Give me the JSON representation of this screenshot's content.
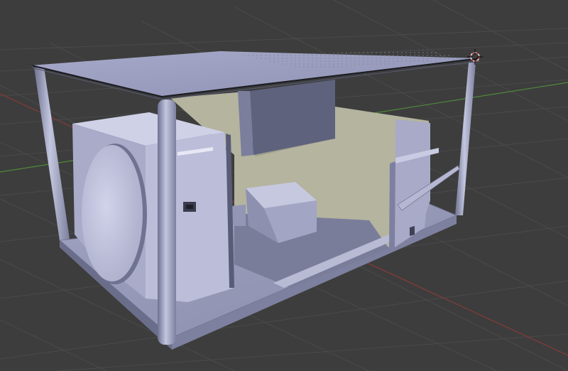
{
  "viewport": {
    "background_color": "#3d3d3d",
    "grid_color": "#4a4a4a",
    "x_axis_color": "#8a3a3a",
    "y_axis_color": "#4f8a3a"
  },
  "model": {
    "base_color": "#a4a6c6",
    "light_color": "#c7c9e2",
    "mid_color": "#8f92b2",
    "dark_color": "#5f627c",
    "deep_color": "#4c4e63",
    "wall_color": "#b4b49f"
  },
  "icons": {
    "origin": "3d-cursor-icon"
  }
}
